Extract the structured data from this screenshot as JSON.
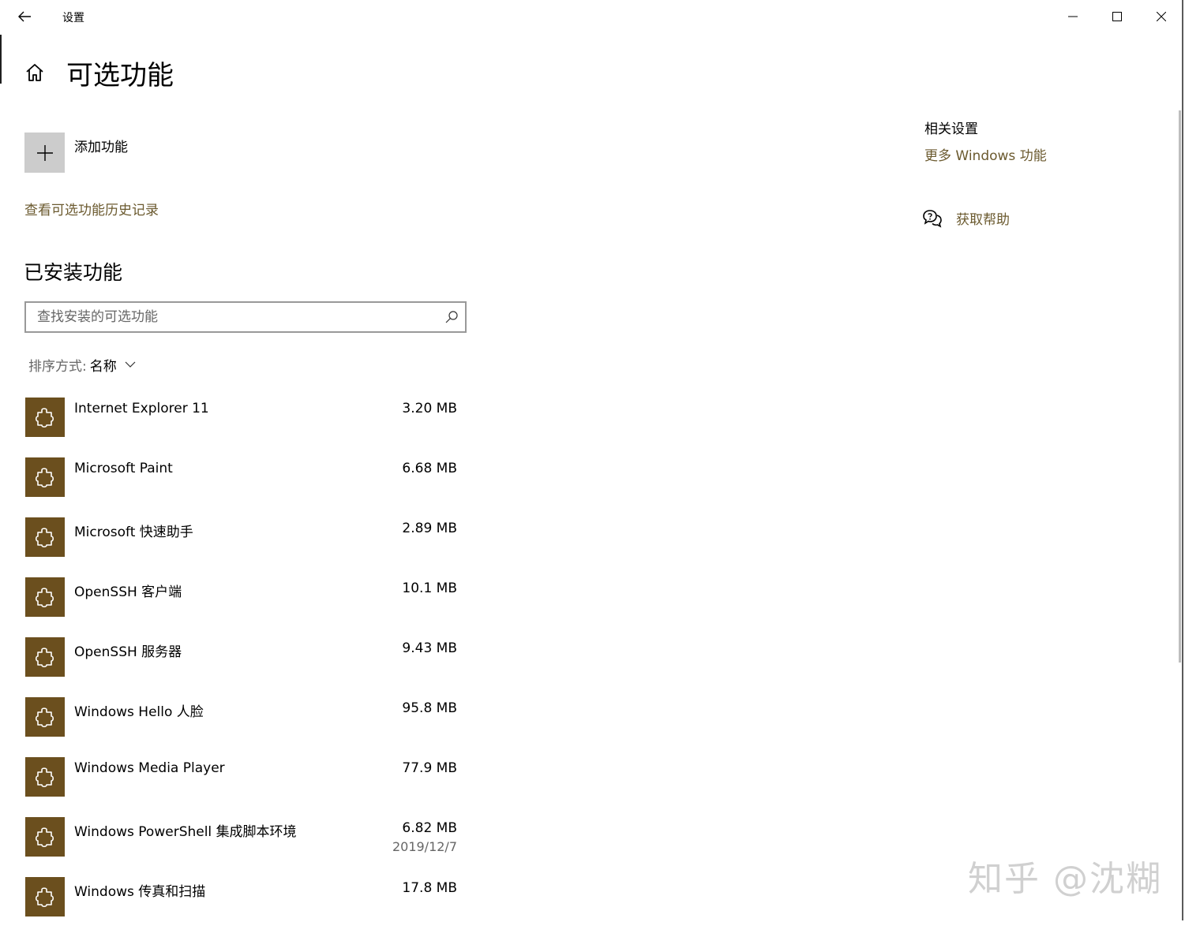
{
  "window": {
    "title": "设置"
  },
  "page": {
    "title": "可选功能"
  },
  "add_feature": {
    "label": "添加功能"
  },
  "history_link": "查看可选功能历史记录",
  "installed": {
    "title": "已安装功能",
    "search_placeholder": "查找安装的可选功能",
    "sort_label": "排序方式:",
    "sort_value": "名称",
    "items": [
      {
        "name": "Internet Explorer 11",
        "size": "3.20 MB",
        "date": ""
      },
      {
        "name": "Microsoft Paint",
        "size": "6.68 MB",
        "date": ""
      },
      {
        "name": "Microsoft 快速助手",
        "size": "2.89 MB",
        "date": ""
      },
      {
        "name": "OpenSSH 客户端",
        "size": "10.1 MB",
        "date": ""
      },
      {
        "name": "OpenSSH 服务器",
        "size": "9.43 MB",
        "date": ""
      },
      {
        "name": "Windows Hello 人脸",
        "size": "95.8 MB",
        "date": ""
      },
      {
        "name": "Windows Media Player",
        "size": "77.9 MB",
        "date": ""
      },
      {
        "name": "Windows PowerShell 集成脚本环境",
        "size": "6.82 MB",
        "date": "2019/12/7"
      },
      {
        "name": "Windows 传真和扫描",
        "size": "17.8 MB",
        "date": ""
      }
    ]
  },
  "related": {
    "title": "相关设置",
    "more_windows_features": "更多 Windows 功能",
    "get_help": "获取帮助"
  },
  "watermark": "知乎 @沈糊",
  "colors": {
    "accent_link": "#6b5a2f",
    "tile_background": "#6b4f1e",
    "add_tile": "#cccccc"
  },
  "icons": {
    "back": "back-arrow-icon",
    "minimize": "minimize-icon",
    "maximize": "maximize-icon",
    "close": "close-icon",
    "home": "home-icon",
    "add": "plus-icon",
    "search": "search-icon",
    "sort": "chevron-down-icon",
    "feature": "puzzle-piece-icon",
    "help": "help-chat-icon"
  }
}
